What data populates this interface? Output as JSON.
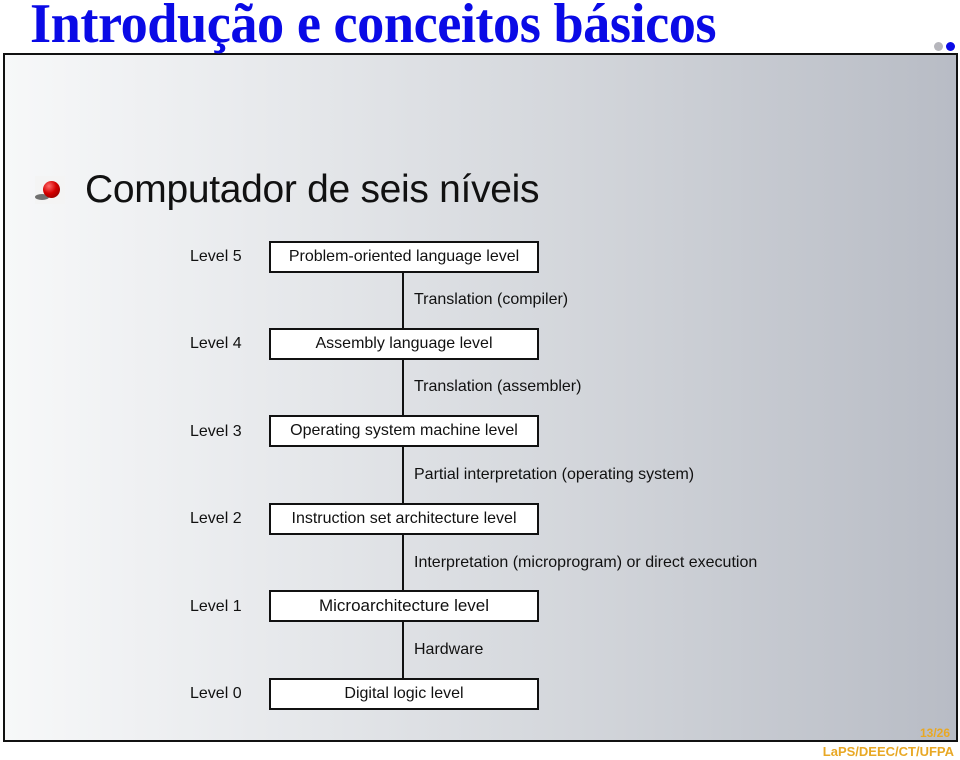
{
  "slide": {
    "title": "Introdução e conceitos básicos",
    "bullet": "Computador de seis níveis",
    "page_number": "13/26",
    "footer": "LaPS/DEEC/CT/UFPA",
    "colors": {
      "title": "#0a0ae6",
      "footer": "#e8a825",
      "bullet": "#d40000"
    },
    "nav_dots": [
      "inactive",
      "active"
    ]
  },
  "diagram": {
    "levels": [
      {
        "label": "Level 5",
        "name": "Problem-oriented language level"
      },
      {
        "label": "Level 4",
        "name": "Assembly language level"
      },
      {
        "label": "Level 3",
        "name": "Operating system machine level"
      },
      {
        "label": "Level 2",
        "name": "Instruction set architecture level"
      },
      {
        "label": "Level 1",
        "name": "Microarchitecture level"
      },
      {
        "label": "Level 0",
        "name": "Digital logic level"
      }
    ],
    "transitions": [
      "Translation (compiler)",
      "Translation (assembler)",
      "Partial interpretation (operating system)",
      "Interpretation (microprogram) or direct execution",
      "Hardware"
    ]
  }
}
